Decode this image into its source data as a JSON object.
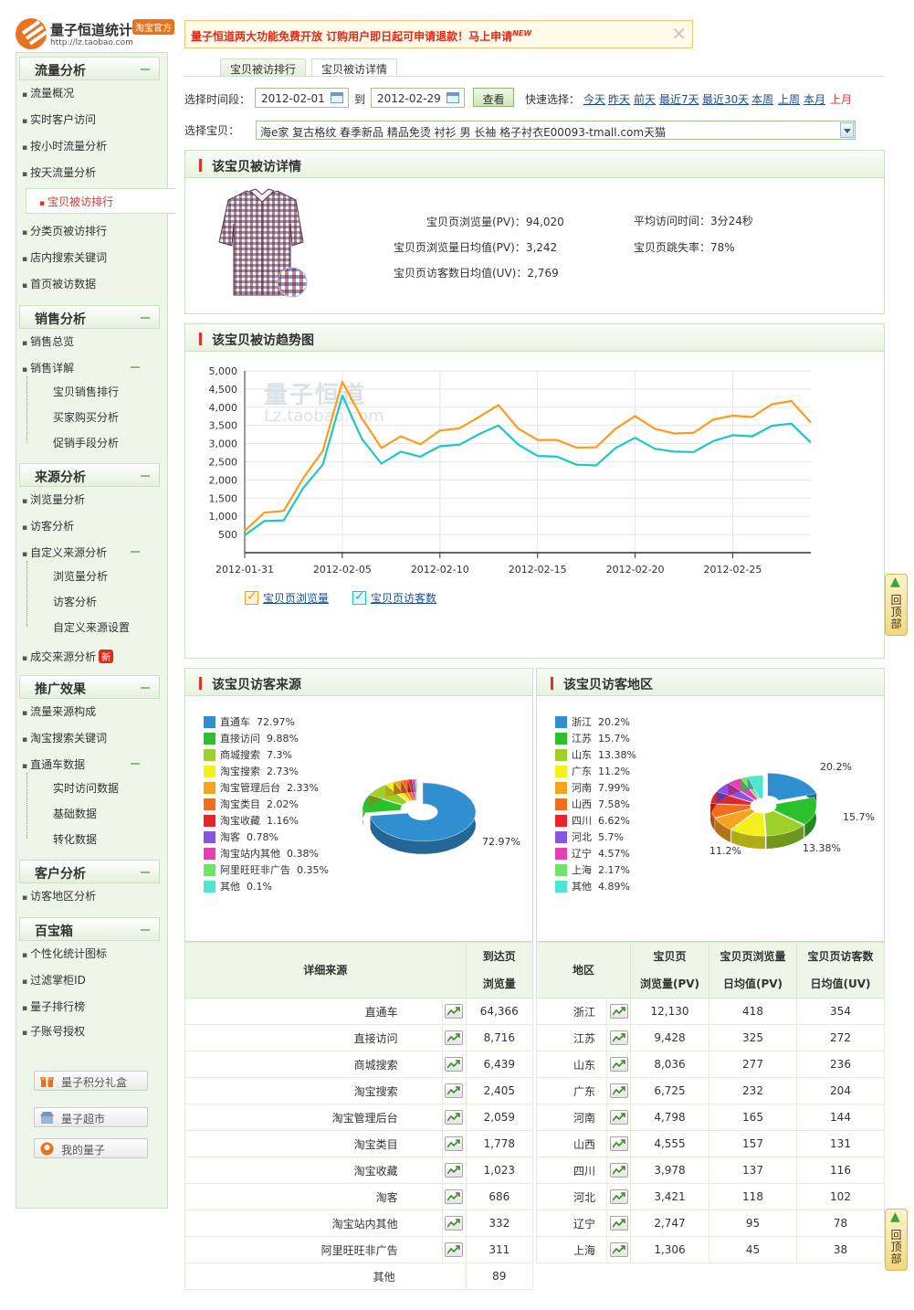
{
  "logo": {
    "name": "量子恒道统计",
    "badge": "淘宝官方",
    "url": "http://lz.taobao.com"
  },
  "notice": {
    "text": "量子恒道两大功能免费开放  订购用户即日起可申请退款！马上申请",
    "new": "NEW",
    "close": "✕"
  },
  "sidebar": {
    "sections": [
      {
        "title": "流量分析",
        "items": [
          "流量概况",
          "实时客户访问",
          "按小时流量分析",
          "按天流量分析",
          "宝贝被访排行",
          "分类页被访排行",
          "店内搜索关键词",
          "首页被访数据"
        ]
      },
      {
        "title": "销售分析",
        "items": [
          "销售总览",
          "销售详解"
        ],
        "subs": [
          "宝贝销售排行",
          "买家购买分析",
          "促销手段分析"
        ]
      },
      {
        "title": "来源分析",
        "items": [
          "浏览量分析",
          "访客分析",
          "自定义来源分析",
          "成交来源分析"
        ],
        "subs": [
          "浏览量分析",
          "访客分析",
          "自定义来源设置"
        ],
        "hot": "新"
      },
      {
        "title": "推广效果",
        "items": [
          "流量来源构成",
          "淘宝搜索关键词",
          "直通车数据"
        ],
        "subs": [
          "实时访问数据",
          "基础数据",
          "转化数据"
        ]
      },
      {
        "title": "客户分析",
        "items": [
          "访客地区分析"
        ]
      },
      {
        "title": "百宝箱",
        "items": [
          "个性化统计图标",
          "过滤掌柜ID",
          "量子排行榜",
          "子账号授权"
        ]
      }
    ],
    "buttons": [
      "量子积分礼盒",
      "量子超市",
      "我的量子"
    ]
  },
  "tabs": [
    "宝贝被访排行",
    "宝贝被访详情"
  ],
  "filter": {
    "time_label": "选择时间段：",
    "start": "2012-02-01",
    "to": "到",
    "end": "2012-02-29",
    "query": "查看",
    "quick_label": "快速选择：",
    "quick": [
      "今天",
      "昨天",
      "前天",
      "最近7天",
      "最近30天",
      "本周",
      "上周",
      "本月",
      "上月"
    ],
    "item_label": "选择宝贝：",
    "item_value": "海e家 复古格纹 春季新品 精品免烫 衬衫 男 长袖 格子衬衣E00093-tmall.com天猫"
  },
  "detail": {
    "title": "该宝贝被访详情",
    "pv_label": "宝贝页浏览量(PV)：",
    "pv": "94,020",
    "pv_avg_label": "宝贝页浏览量日均值(PV)：",
    "pv_avg": "3,242",
    "uv_avg_label": "宝贝页访客数日均值(UV)：",
    "uv_avg": "2,769",
    "time_label": "平均访问时间：",
    "time": "3分24秒",
    "bounce_label": "宝贝页跳失率：",
    "bounce": "78%"
  },
  "trend": {
    "title": "该宝贝被访趋势图",
    "watermark": "量子恒道",
    "watermark2": "Lz.taobao.com",
    "colors": {
      "pv": "#ff9a1a",
      "uv": "#1fc6c8"
    }
  },
  "chart_data": {
    "type": "line",
    "x": [
      "2012-01-31",
      "2012-02-01",
      "2012-02-02",
      "2012-02-03",
      "2012-02-04",
      "2012-02-05",
      "2012-02-06",
      "2012-02-07",
      "2012-02-08",
      "2012-02-09",
      "2012-02-10",
      "2012-02-11",
      "2012-02-12",
      "2012-02-13",
      "2012-02-14",
      "2012-02-15",
      "2012-02-16",
      "2012-02-17",
      "2012-02-18",
      "2012-02-19",
      "2012-02-20",
      "2012-02-21",
      "2012-02-22",
      "2012-02-23",
      "2012-02-24",
      "2012-02-25",
      "2012-02-26",
      "2012-02-27",
      "2012-02-28",
      "2012-02-29"
    ],
    "xticks": [
      "2012-01-31",
      "2012-02-05",
      "2012-02-10",
      "2012-02-15",
      "2012-02-20",
      "2012-02-25"
    ],
    "series": [
      {
        "name": "宝贝页浏览量",
        "values": [
          600,
          1100,
          1150,
          2050,
          2800,
          4700,
          3700,
          2880,
          3200,
          2980,
          3360,
          3420,
          3730,
          4060,
          3420,
          3100,
          3100,
          2890,
          2900,
          3410,
          3760,
          3410,
          3280,
          3300,
          3660,
          3770,
          3730,
          4080,
          4170,
          3580
        ]
      },
      {
        "name": "宝贝页访客数",
        "values": [
          480,
          870,
          890,
          1780,
          2420,
          4320,
          3130,
          2450,
          2780,
          2640,
          2930,
          2970,
          3260,
          3500,
          2980,
          2660,
          2640,
          2420,
          2400,
          2880,
          3160,
          2860,
          2780,
          2770,
          3070,
          3230,
          3200,
          3490,
          3550,
          3030
        ]
      }
    ],
    "ylim": [
      0,
      5000
    ],
    "yticks": [
      500,
      1000,
      1500,
      2000,
      2500,
      3000,
      3500,
      4000,
      4500,
      5000
    ],
    "ytick_labels": [
      "500",
      "1,000",
      "1,500",
      "2,000",
      "2,500",
      "3,000",
      "3,500",
      "4,000",
      "4,500",
      "5,000"
    ],
    "grid": true,
    "legend": "bottom-left"
  },
  "source": {
    "title": "该宝贝访客来源",
    "legend": [
      {
        "name": "直通车",
        "pct": "72.97%",
        "color": "#2f8fd1"
      },
      {
        "name": "直接访问",
        "pct": "9.88%",
        "color": "#2bc12c"
      },
      {
        "name": "商城搜索",
        "pct": "7.3%",
        "color": "#9dd12a"
      },
      {
        "name": "淘宝搜索",
        "pct": "2.73%",
        "color": "#f5ef1a"
      },
      {
        "name": "淘宝管理后台",
        "pct": "2.33%",
        "color": "#f6a31e"
      },
      {
        "name": "淘宝类目",
        "pct": "2.02%",
        "color": "#f26d1e"
      },
      {
        "name": "淘宝收藏",
        "pct": "1.16%",
        "color": "#e8242b"
      },
      {
        "name": "淘客",
        "pct": "0.78%",
        "color": "#8a54e3"
      },
      {
        "name": "淘宝站内其他",
        "pct": "0.38%",
        "color": "#e43fb3"
      },
      {
        "name": "阿里旺旺非广告",
        "pct": "0.35%",
        "color": "#6fe36a"
      },
      {
        "name": "其他",
        "pct": "0.1%",
        "color": "#4ee5d2"
      }
    ],
    "pie_label": "72.97%"
  },
  "region": {
    "title": "该宝贝访客地区",
    "legend": [
      {
        "name": "浙江",
        "pct": "20.2%",
        "color": "#2f8fd1"
      },
      {
        "name": "江苏",
        "pct": "15.7%",
        "color": "#2bc12c"
      },
      {
        "name": "山东",
        "pct": "13.38%",
        "color": "#9dd12a"
      },
      {
        "name": "广东",
        "pct": "11.2%",
        "color": "#f5ef1a"
      },
      {
        "name": "河南",
        "pct": "7.99%",
        "color": "#f6a31e"
      },
      {
        "name": "山西",
        "pct": "7.58%",
        "color": "#f26d1e"
      },
      {
        "name": "四川",
        "pct": "6.62%",
        "color": "#e8242b"
      },
      {
        "name": "河北",
        "pct": "5.7%",
        "color": "#8a54e3"
      },
      {
        "name": "辽宁",
        "pct": "4.57%",
        "color": "#e43fb3"
      },
      {
        "name": "上海",
        "pct": "2.17%",
        "color": "#6fe36a"
      },
      {
        "name": "其他",
        "pct": "4.89%",
        "color": "#4ee5d2"
      }
    ],
    "labels": [
      "20.2%",
      "15.7%",
      "13.38%",
      "11.2%"
    ]
  },
  "source_table": {
    "headers": [
      "详细来源",
      "到达页",
      "浏览量"
    ],
    "rows": [
      [
        "直通车",
        "64,366"
      ],
      [
        "直接访问",
        "8,716"
      ],
      [
        "商城搜索",
        "6,439"
      ],
      [
        "淘宝搜索",
        "2,405"
      ],
      [
        "淘宝管理后台",
        "2,059"
      ],
      [
        "淘宝类目",
        "1,778"
      ],
      [
        "淘宝收藏",
        "1,023"
      ],
      [
        "淘客",
        "686"
      ],
      [
        "淘宝站内其他",
        "332"
      ],
      [
        "阿里旺旺非广告",
        "311"
      ],
      [
        "其他",
        "89"
      ]
    ]
  },
  "region_table": {
    "headers": [
      "地区",
      "宝贝页",
      "浏览量(PV)",
      "宝贝页浏览量",
      "日均值(PV)",
      "宝贝页访客数",
      "日均值(UV)"
    ],
    "rows": [
      [
        "浙江",
        "12,130",
        "418",
        "354"
      ],
      [
        "江苏",
        "9,428",
        "325",
        "272"
      ],
      [
        "山东",
        "8,036",
        "277",
        "236"
      ],
      [
        "广东",
        "6,725",
        "232",
        "204"
      ],
      [
        "河南",
        "4,798",
        "165",
        "144"
      ],
      [
        "山西",
        "4,555",
        "157",
        "131"
      ],
      [
        "四川",
        "3,978",
        "137",
        "116"
      ],
      [
        "河北",
        "3,421",
        "118",
        "102"
      ],
      [
        "辽宁",
        "2,747",
        "95",
        "78"
      ],
      [
        "上海",
        "1,306",
        "45",
        "38"
      ]
    ]
  },
  "back_top": "回顶部"
}
